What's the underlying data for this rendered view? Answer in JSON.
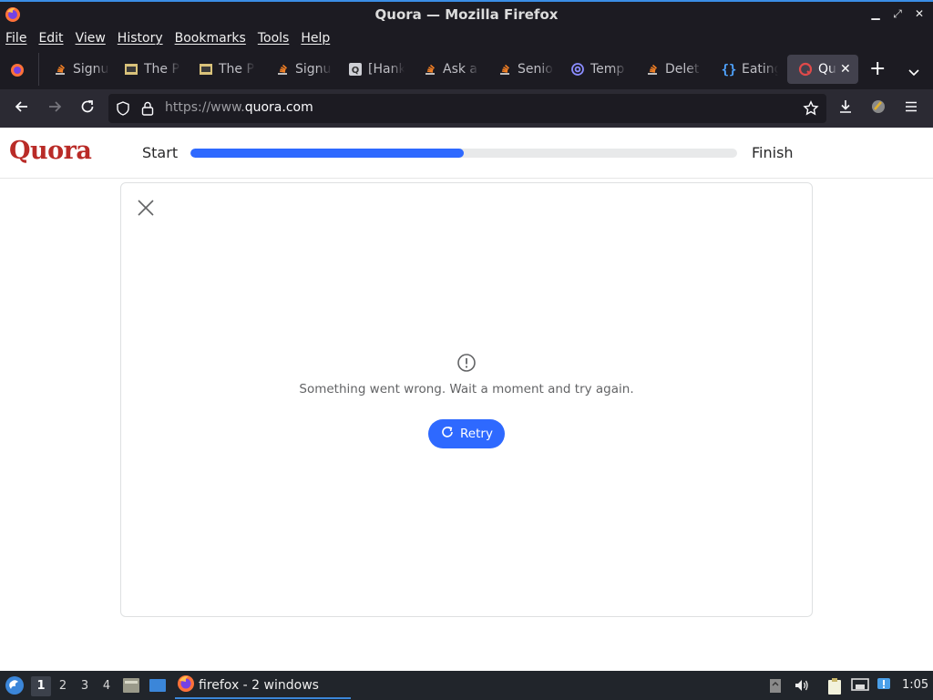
{
  "window": {
    "title": "Quora — Mozilla Firefox"
  },
  "menu": [
    "File",
    "Edit",
    "View",
    "History",
    "Bookmarks",
    "Tools",
    "Help"
  ],
  "tabs": [
    {
      "label": "Signu",
      "icon": "stackoverflow-icon"
    },
    {
      "label": "The P",
      "icon": "film-icon"
    },
    {
      "label": "The P",
      "icon": "film-icon"
    },
    {
      "label": "Signu",
      "icon": "stackoverflow-icon"
    },
    {
      "label": "[Hank",
      "icon": "quora-icon"
    },
    {
      "label": "Ask a",
      "icon": "stackoverflow-icon"
    },
    {
      "label": "Senio",
      "icon": "stackoverflow-icon"
    },
    {
      "label": "Temp",
      "icon": "at-icon"
    },
    {
      "label": "Delet",
      "icon": "stackoverflow-icon"
    },
    {
      "label": "Eating",
      "icon": "braces-icon"
    },
    {
      "label": "Quo",
      "icon": "quora-red-icon",
      "active": true
    }
  ],
  "urlbar": {
    "prefix": "https://www.",
    "domain": "quora.com"
  },
  "page": {
    "logo": "Quora",
    "start_label": "Start",
    "finish_label": "Finish",
    "progress": 0.5,
    "error_message": "Something went wrong. Wait a moment and try again.",
    "retry_label": "Retry"
  },
  "taskbar": {
    "workspaces": [
      "1",
      "2",
      "3",
      "4"
    ],
    "active_workspace": "1",
    "task_label": "firefox - 2 windows",
    "clock": "1:05"
  },
  "colors": {
    "accent": "#2e69ff",
    "quora_red": "#b92b27"
  }
}
